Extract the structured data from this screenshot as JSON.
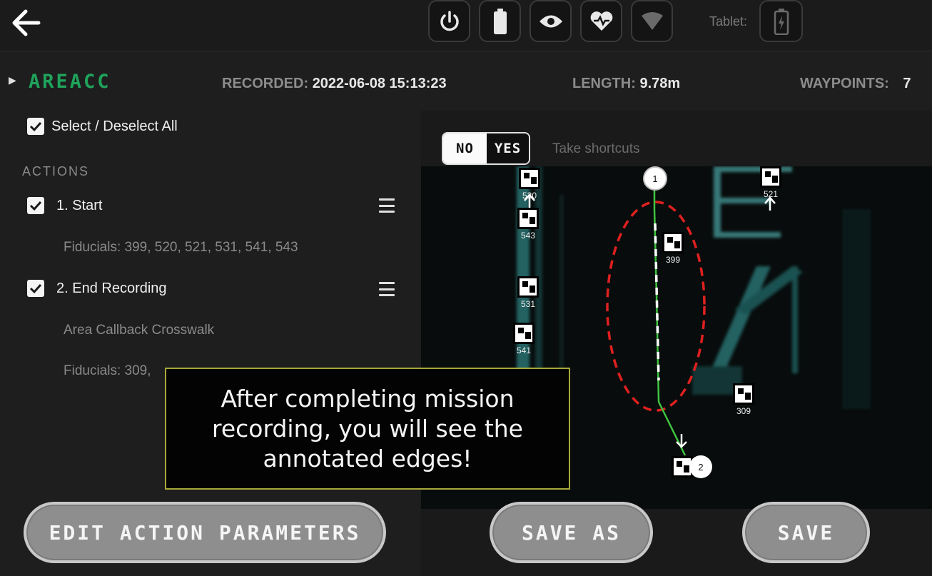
{
  "top_bar": {
    "back_icon": "arrow-left-icon",
    "status_icons": [
      "power-icon",
      "battery-icon",
      "eye-icon",
      "heart-icon",
      "wifi-icon"
    ],
    "tablet_label": "Tablet:",
    "tablet_icon": "tablet-battery-icon"
  },
  "mission": {
    "name": "AREACC",
    "recorded_label": "RECORDED:",
    "recorded_value": "2022-06-08 15:13:23",
    "length_label": "LENGTH:",
    "length_value": "9.78m",
    "waypoints_label": "WAYPOINTS:",
    "waypoints_value": "7"
  },
  "actions_panel": {
    "select_all_label": "Select / Deselect All",
    "actions_title": "ACTIONS",
    "items": [
      {
        "label": "1. Start",
        "details": [
          "Fiducials: 399, 520, 521, 531, 541, 543"
        ]
      },
      {
        "label": "2. End Recording",
        "details": [
          "Area Callback Crosswalk",
          "Fiducials: 309,"
        ]
      }
    ]
  },
  "map": {
    "toggle_no": "NO",
    "toggle_yes": "YES",
    "toggle_selected": "YES",
    "toggle_label": "Take shortcuts",
    "fiducials": [
      "520",
      "543",
      "531",
      "541",
      "399",
      "521",
      "309"
    ],
    "waypoints": [
      "1",
      "2"
    ],
    "colors": {
      "path": "#3fc43f",
      "annotation": "#e02020",
      "point_cloud": "#4fc7c7"
    }
  },
  "tooltip": {
    "text": "After completing mission\nrecording, you will see the\nannotated edges!"
  },
  "buttons": {
    "edit_action_parameters": "EDIT ACTION PARAMETERS",
    "save_as": "SAVE AS",
    "save": "SAVE"
  },
  "colors": {
    "accent_green": "#1fa35b",
    "tooltip_border": "#a8a83a",
    "button_fill": "#8e8e8e"
  }
}
